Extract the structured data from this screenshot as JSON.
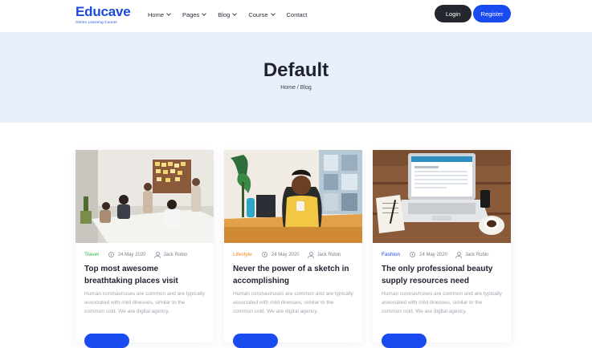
{
  "header": {
    "logo_title": "Educave",
    "logo_subtitle": "Online Learning Course",
    "nav": [
      {
        "label": "Home",
        "has_dropdown": true
      },
      {
        "label": "Pages",
        "has_dropdown": true
      },
      {
        "label": "Blog",
        "has_dropdown": true
      },
      {
        "label": "Course",
        "has_dropdown": true
      },
      {
        "label": "Contact",
        "has_dropdown": false
      }
    ],
    "login_label": "Login",
    "register_label": "Register"
  },
  "hero": {
    "title": "Default",
    "breadcrumb": "Home / Blog"
  },
  "cards": [
    {
      "category": "Travel",
      "category_color": "#2fb34a",
      "date": "24 May 2020",
      "author": "Jack Robin",
      "title": "Top most awesome breathtaking places visit",
      "excerpt": "Human coronaviruses are common and are typically associated with mild illnesses, similar to the common cold. We are digital agency."
    },
    {
      "category": "Lifestyle",
      "category_color": "#f5821f",
      "date": "24 May 2020",
      "author": "Jack Robin",
      "title": "Never the power of a sketch in accomplishing",
      "excerpt": "Human coronaviruses are common and are typically associated with mild illnesses, similar to the common cold. We are digital agency."
    },
    {
      "category": "Fashion",
      "category_color": "#1a4bef",
      "date": "24 May 2020",
      "author": "Jack Robin",
      "title": "The only professional beauty supply resources need",
      "excerpt": "Human coronaviruses are common and are typically associated with mild illnesses, similar to the common cold. We are digital agency."
    }
  ],
  "colors": {
    "brand": "#1a4bef",
    "hero_bg": "#e9f0f9",
    "dark_button": "#24272e"
  }
}
